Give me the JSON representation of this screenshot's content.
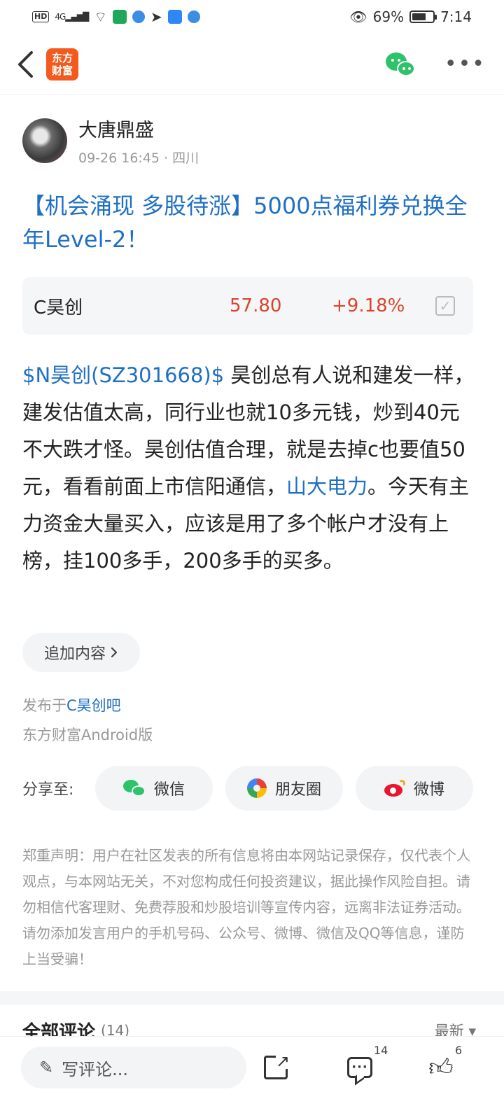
{
  "status_bar": {
    "left_tags": [
      "HD",
      "4G"
    ],
    "battery_text": "69%",
    "battery_level": 0.69,
    "time": "7:14"
  },
  "nav": {
    "logo_line1": "东方",
    "logo_line2": "财富"
  },
  "author": {
    "name": "大唐鼎盛",
    "meta": "09-26 16:45 · 四川"
  },
  "post": {
    "title": "【机会涌现 多股待涨】5000点福利券兑换全年Level-2！",
    "stock": {
      "name": "C昊创",
      "price": "57.80",
      "change": "+9.18%"
    },
    "body_link1": "$N昊创(SZ301668)$",
    "body_part1": " 昊创总有人说和建发一样，建发估值太高，同行业也就10多元钱，炒到40元不大跌才怪。昊创估值合理，就是去掉c也要值50元，看看前面上市信阳通信，",
    "body_link2": "山大电力",
    "body_part2": "。今天有主力资金大量买入，应该是用了多个帐户才没有上榜，挂100多手，200多手的买多。"
  },
  "add_content_label": "追加内容",
  "publish": {
    "prefix": "发布于",
    "bar_name": "C昊创吧",
    "client": "东方财富Android版"
  },
  "share": {
    "label": "分享至:",
    "wechat": "微信",
    "moments": "朋友圈",
    "weibo": "微博"
  },
  "disclaimer": "郑重声明：用户在社区发表的所有信息将由本网站记录保存，仅代表个人观点，与本网站无关，不对您构成任何投资建议，据此操作风险自担。请勿相信代客理财、免费荐股和炒股培训等宣传内容，远离非法证券活动。请勿添加发言用户的手机号码、公众号、微博、微信及QQ等信息，谨防上当受骗！",
  "comments": {
    "title": "全部评论",
    "count": "(14)",
    "sort": "最新 ▾"
  },
  "bottom_bar": {
    "input_placeholder": "写评论...",
    "comment_count": "14",
    "like_count": "6"
  }
}
